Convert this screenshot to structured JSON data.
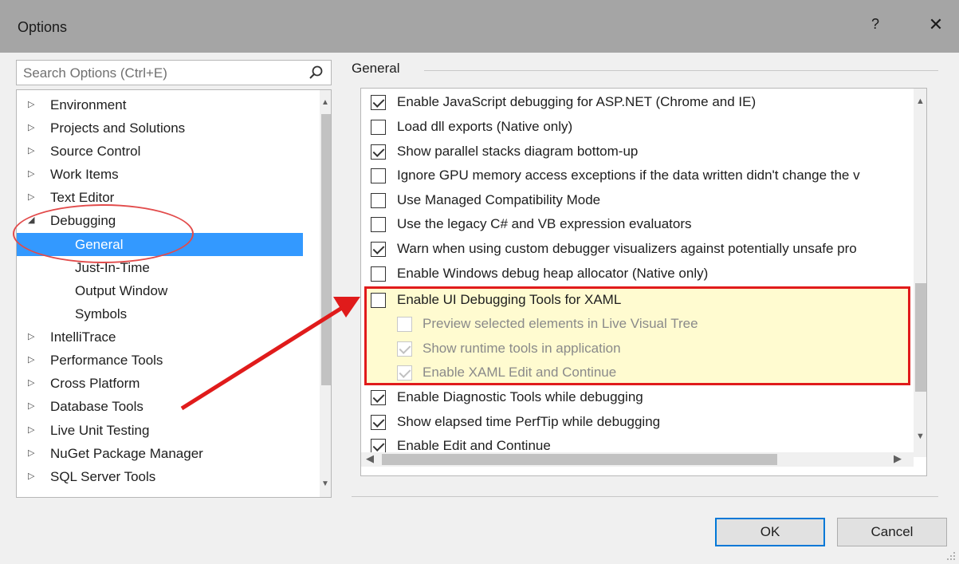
{
  "window": {
    "title": "Options",
    "help_label": "?",
    "close_label": "✕"
  },
  "search": {
    "placeholder": "Search Options (Ctrl+E)",
    "icon": "search-icon"
  },
  "tree": {
    "items": [
      {
        "label": "Environment",
        "arrow": "▷"
      },
      {
        "label": "Projects and Solutions",
        "arrow": "▷"
      },
      {
        "label": "Source Control",
        "arrow": "▷"
      },
      {
        "label": "Work Items",
        "arrow": "▷"
      },
      {
        "label": "Text Editor",
        "arrow": "▷"
      },
      {
        "label": "Debugging",
        "arrow": "◢"
      },
      {
        "label": "General"
      },
      {
        "label": "Just-In-Time"
      },
      {
        "label": "Output Window"
      },
      {
        "label": "Symbols"
      },
      {
        "label": "IntelliTrace",
        "arrow": "▷"
      },
      {
        "label": "Performance Tools",
        "arrow": "▷"
      },
      {
        "label": "Cross Platform",
        "arrow": "▷"
      },
      {
        "label": "Database Tools",
        "arrow": "▷"
      },
      {
        "label": "Live Unit Testing",
        "arrow": "▷"
      },
      {
        "label": "NuGet Package Manager",
        "arrow": "▷"
      },
      {
        "label": "SQL Server Tools",
        "arrow": "▷"
      }
    ],
    "selected": "General"
  },
  "section": {
    "title": "General"
  },
  "options": [
    {
      "label": "Enable JavaScript debugging for ASP.NET (Chrome and IE)",
      "checked": true
    },
    {
      "label": "Load dll exports (Native only)",
      "checked": false
    },
    {
      "label": "Show parallel stacks diagram bottom-up",
      "checked": true
    },
    {
      "label": "Ignore GPU memory access exceptions if the data written didn't change the v",
      "checked": false
    },
    {
      "label": "Use Managed Compatibility Mode",
      "checked": false
    },
    {
      "label": "Use the legacy C# and VB expression evaluators",
      "checked": false
    },
    {
      "label": "Warn when using custom debugger visualizers against potentially unsafe pro",
      "checked": true
    },
    {
      "label": "Enable Windows debug heap allocator (Native only)",
      "checked": false
    },
    {
      "label": "Enable UI Debugging Tools for XAML",
      "checked": false
    },
    {
      "label": "Preview selected elements in Live Visual Tree",
      "checked": false
    },
    {
      "label": "Show runtime tools in application",
      "checked": true
    },
    {
      "label": "Enable XAML Edit and Continue",
      "checked": true
    },
    {
      "label": "Enable Diagnostic Tools while debugging",
      "checked": true
    },
    {
      "label": "Show elapsed time PerfTip while debugging",
      "checked": true
    },
    {
      "label": "Enable Edit and Continue",
      "checked": true
    }
  ],
  "buttons": {
    "ok": "OK",
    "cancel": "Cancel"
  },
  "colors": {
    "selection": "#3399ff",
    "annotation_red": "#e01b1b",
    "highlight_fill": "#fffbd0"
  }
}
